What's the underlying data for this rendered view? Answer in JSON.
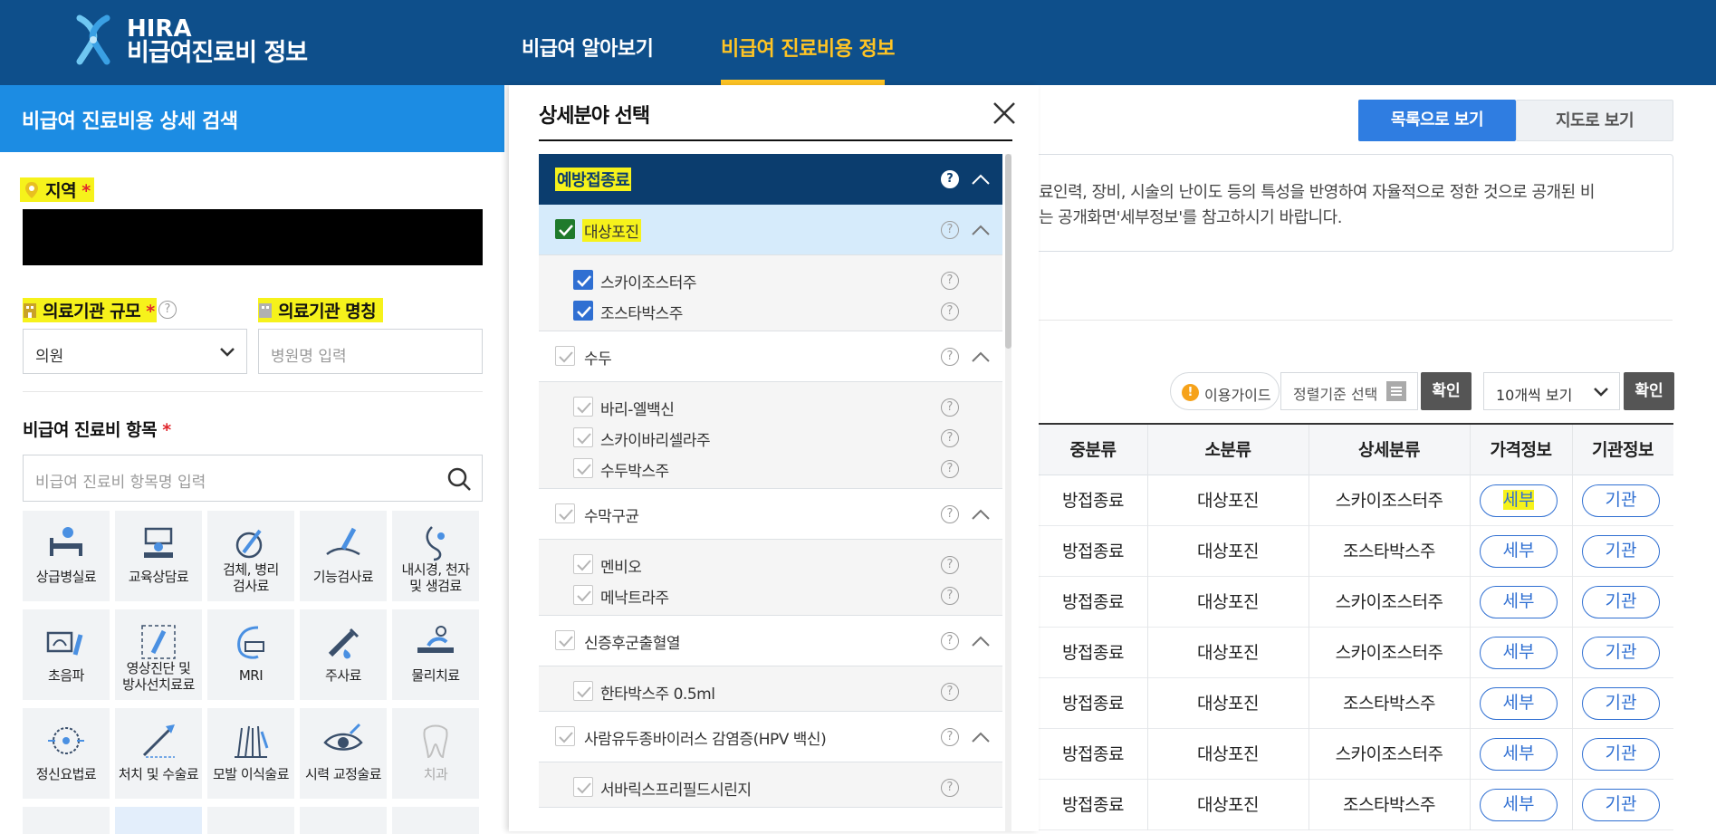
{
  "header": {
    "logo_line1": "HIRA",
    "logo_line2": "비급여진료비 정보",
    "nav": [
      "비급여 알아보기",
      "비급여 진료비용 정보"
    ],
    "active_nav_color": "#ffc424"
  },
  "left_panel": {
    "title": "비급여 진료비용 상세 검색",
    "region_label": "지역",
    "required_mark": "*",
    "scale_label": "의료기관 규모",
    "name_label": "의료기관 명칭",
    "scale_value": "의원",
    "name_placeholder": "병원명 입력",
    "item_label": "비급여 진료비 항목",
    "item_placeholder": "비급여 진료비 항목명 입력",
    "categories": [
      "상급병실료",
      "교육상담료",
      "검체, 병리\n검사료",
      "기능검사료",
      "내시경, 천자\n및 생검료",
      "초음파",
      "영상진단 및\n방사선치료료",
      "MRI",
      "주사료",
      "물리치료",
      "정신요법료",
      "처치 및 수술료",
      "모발 이식술료",
      "시력 교정술료",
      "치과"
    ]
  },
  "modal": {
    "title": "상세분야 선택",
    "top_group": "예방접종료",
    "groups": [
      {
        "label": "대상포진",
        "checked": true,
        "items": [
          {
            "label": "스카이조스터주",
            "checked": true
          },
          {
            "label": "조스타박스주",
            "checked": true
          }
        ]
      },
      {
        "label": "수두",
        "checked": false,
        "items": [
          {
            "label": "바리-엘백신",
            "checked": false
          },
          {
            "label": "스카이바리셀라주",
            "checked": false
          },
          {
            "label": "수두박스주",
            "checked": false
          }
        ]
      },
      {
        "label": "수막구균",
        "checked": false,
        "items": [
          {
            "label": "멘비오",
            "checked": false
          },
          {
            "label": "메낙트라주",
            "checked": false
          }
        ]
      },
      {
        "label": "신증후군출혈열",
        "checked": false,
        "items": [
          {
            "label": "한타박스주 0.5ml",
            "checked": false
          }
        ]
      },
      {
        "label": "사람유두종바이러스 감염증(HPV 백신)",
        "checked": false,
        "items": [
          {
            "label": "서바릭스프리필드시린지",
            "checked": false
          }
        ]
      }
    ]
  },
  "right": {
    "view_list": "목록으로 보기",
    "view_map": "지도로 보기",
    "notice_line1": "료인력, 장비, 시술의 난이도 등의 특성을 반영하여 자율적으로 정한 것으로 공개된 비",
    "notice_line2": "는 공개화면'세부정보'를 참고하시기 바랍니다.",
    "guide": "이용가이드",
    "sort_placeholder": "정렬기준 선택",
    "confirm": "확인",
    "page_size": "10개씩 보기",
    "columns": [
      "중분류",
      "소분류",
      "상세분류",
      "가격정보",
      "기관정보"
    ],
    "rows": [
      [
        "방접종료",
        "대상포진",
        "스카이조스터주",
        "세부",
        "기관"
      ],
      [
        "방접종료",
        "대상포진",
        "조스타박스주",
        "세부",
        "기관"
      ],
      [
        "방접종료",
        "대상포진",
        "스카이조스터주",
        "세부",
        "기관"
      ],
      [
        "방접종료",
        "대상포진",
        "스카이조스터주",
        "세부",
        "기관"
      ],
      [
        "방접종료",
        "대상포진",
        "조스타박스주",
        "세부",
        "기관"
      ],
      [
        "방접종료",
        "대상포진",
        "스카이조스터주",
        "세부",
        "기관"
      ],
      [
        "방접종료",
        "대상포진",
        "조스타박스주",
        "세부",
        "기관"
      ]
    ],
    "accent": "#2f6fd2"
  }
}
